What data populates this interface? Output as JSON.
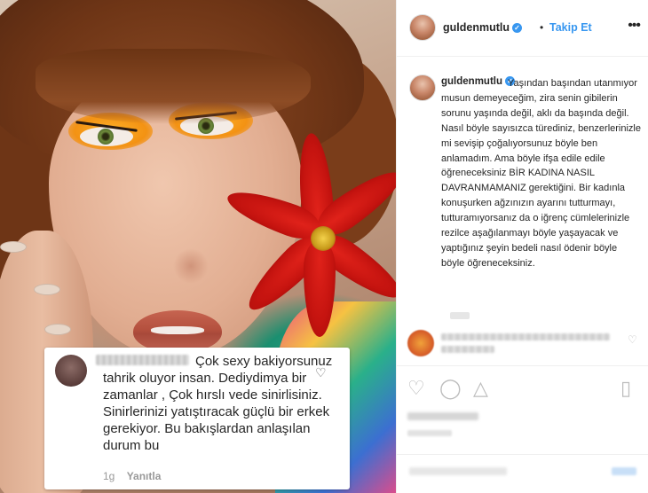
{
  "post": {
    "username": "guldenmutlu",
    "follow_label": "Takip Et",
    "dot": "•",
    "more_icon": "more-horizontal-icon",
    "caption": "Yaşından başından utanmıyor musun demeyeceğim, zira senin gibilerin sorunu yaşında değil, aklı da başında değil. Nasıl böyle sayısızca türediniz, benzerlerinizle mi sevişip çoğalıyorsunuz böyle ben anlamadım. Ama böyle ifşa edile edile öğreneceksiniz BİR KADINA NASIL DAVRANMAMANIZ gerektiğini. Bir kadınla konuşurken ağzınızın ayarını tutturmayı, tutturamıyorsanız da o iğrenç cümlelerinizle rezilce aşağılanmayı böyle yaşayacak ve yaptığınız şeyin bedeli nasıl ödenir böyle böyle öğreneceksiniz."
  },
  "comment_overlay": {
    "text": "Çok sexy bakiyorsunuz tahrik oluyor insan. Dediydimya bir zamanlar , Çok hırslı vede sinirlisiniz. Sinirlerinizi yatıştıracak güçlü bir erkek gerekiyor. Bu bakışlardan anlaşılan durum bu",
    "age": "1g",
    "reply_label": "Yanıtla"
  },
  "colors": {
    "link_blue": "#3897f0",
    "text": "#262626",
    "muted": "#999999"
  },
  "icons": {
    "heart": "heart-icon",
    "comment": "comment-icon",
    "share": "share-icon",
    "bookmark": "bookmark-icon",
    "verified": "verified-badge-icon"
  }
}
